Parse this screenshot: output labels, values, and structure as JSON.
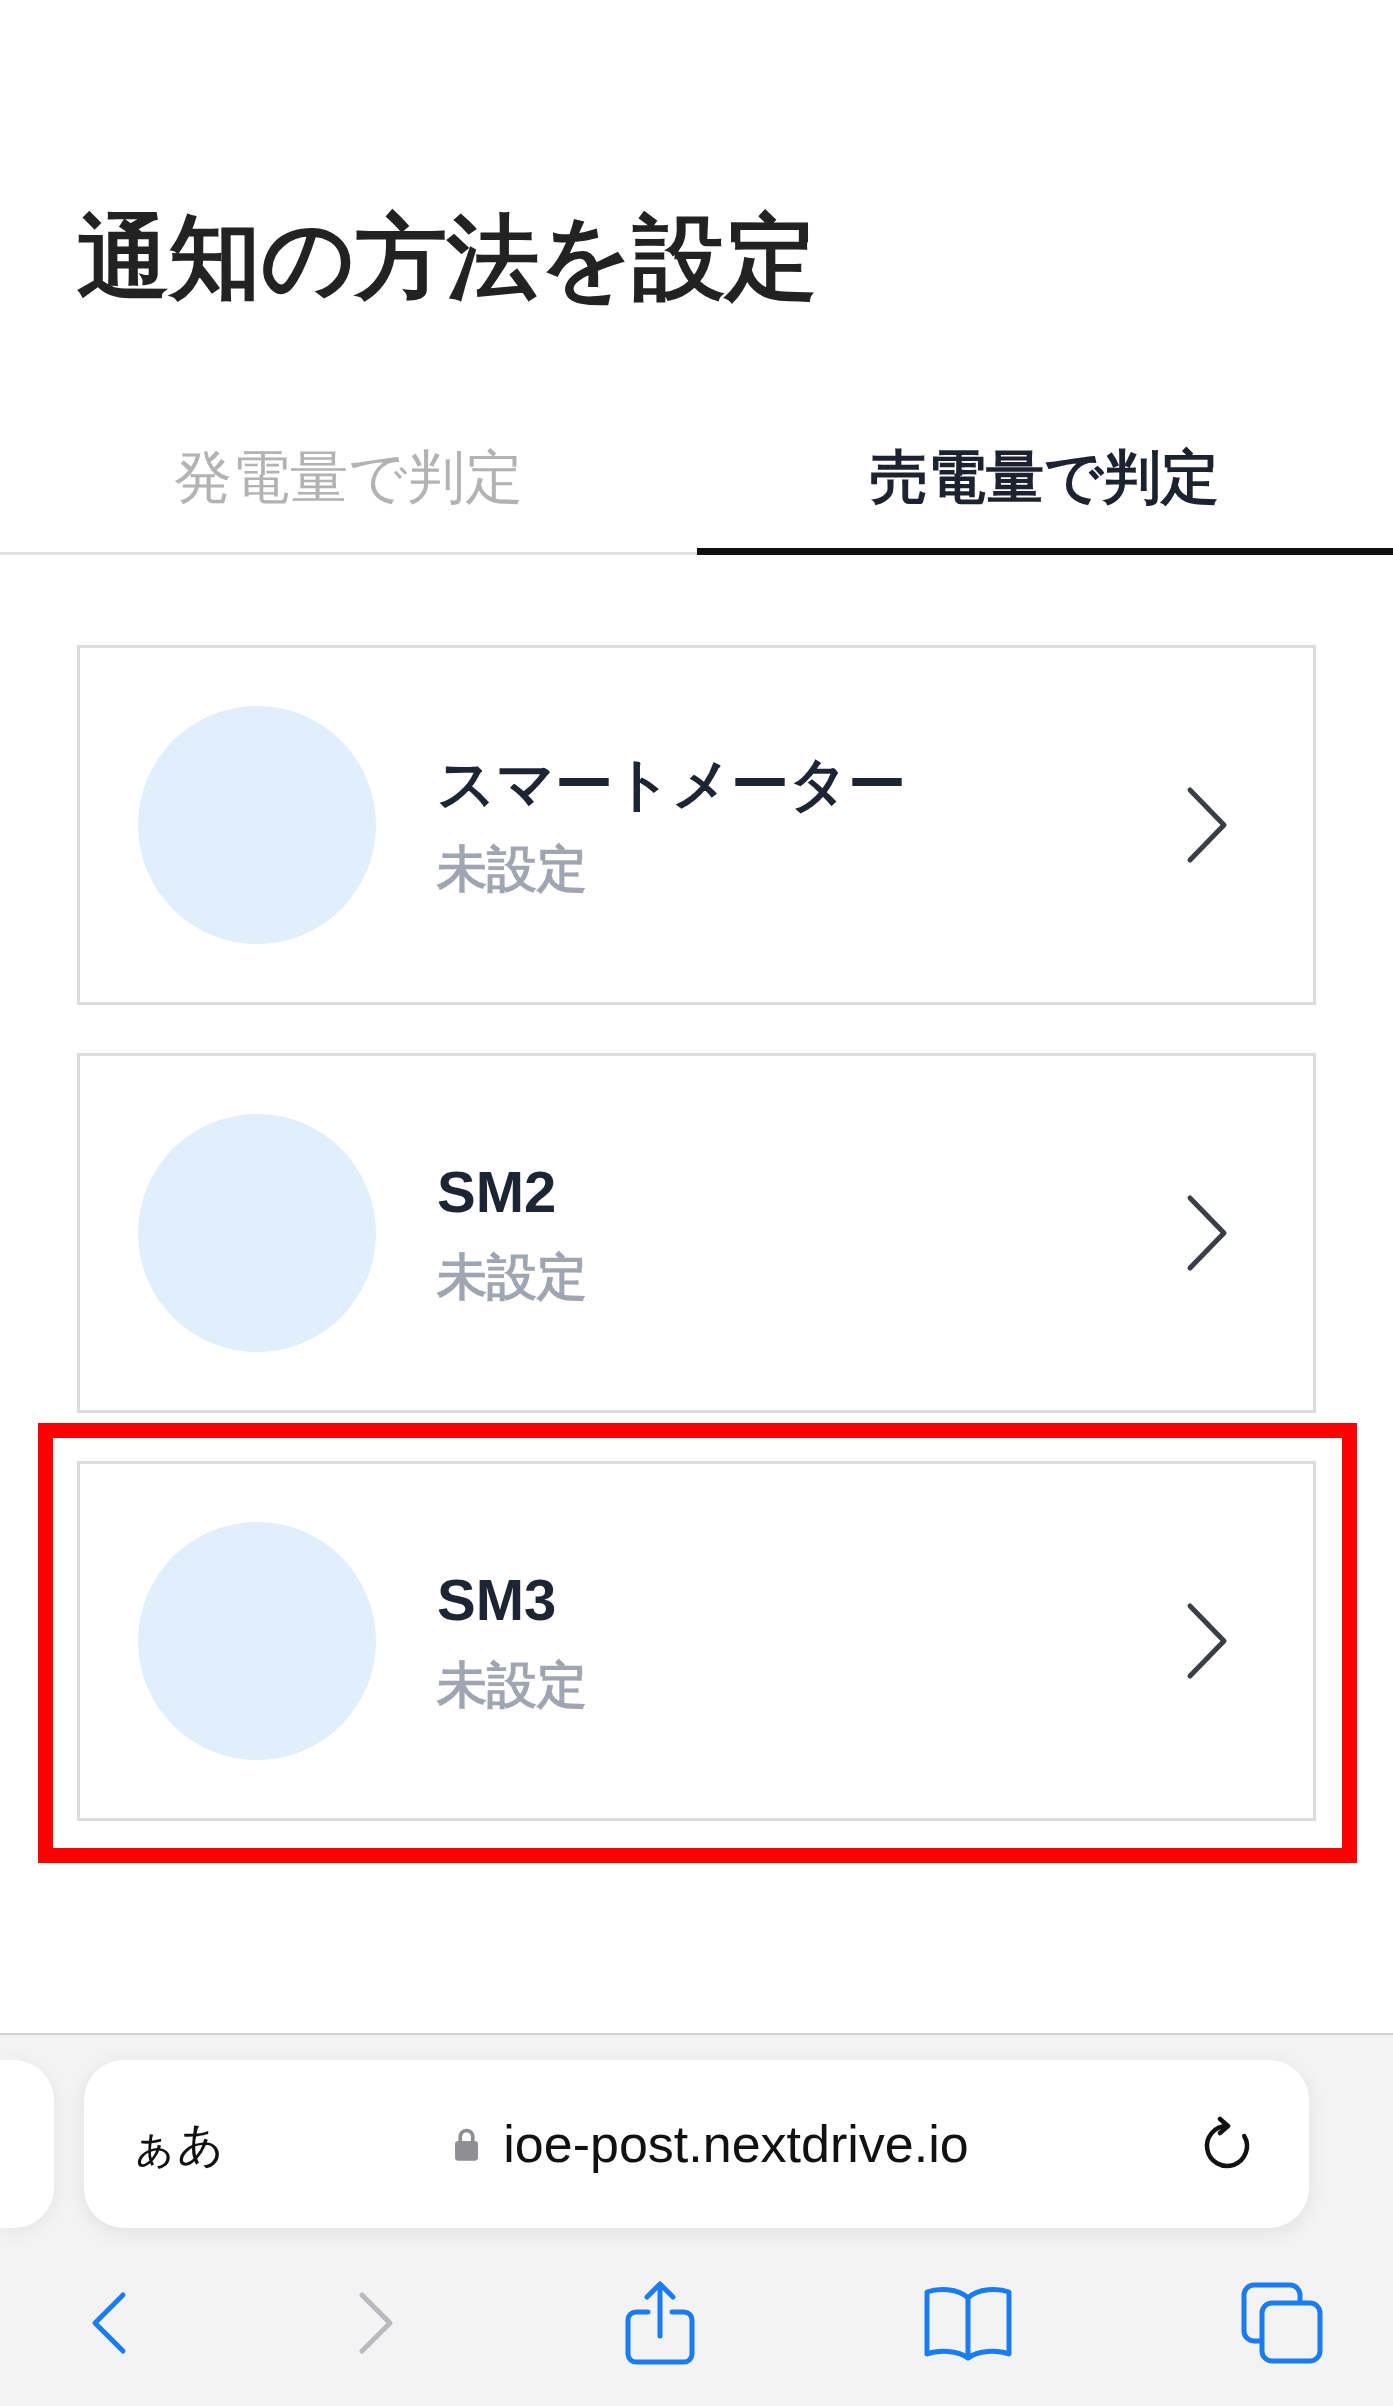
{
  "page": {
    "title": "通知の方法を設定"
  },
  "tabs": [
    {
      "label": "発電量で判定",
      "selected": false
    },
    {
      "label": "売電量で判定",
      "selected": true
    }
  ],
  "devices": [
    {
      "name": "スマートメーター",
      "status": "未設定",
      "highlighted": false
    },
    {
      "name": "SM2",
      "status": "未設定",
      "highlighted": false
    },
    {
      "name": "SM3",
      "status": "未設定",
      "highlighted": true
    }
  ],
  "browser_bar": {
    "text_size_button": "ぁあ",
    "secure": true,
    "url": "ioe-post.nextdrive.io"
  },
  "toolbar": [
    {
      "kind": "back",
      "disabled": false
    },
    {
      "kind": "forward",
      "disabled": true
    },
    {
      "kind": "share",
      "disabled": false
    },
    {
      "kind": "bookmarks",
      "disabled": false
    },
    {
      "kind": "tabs",
      "disabled": false
    }
  ]
}
